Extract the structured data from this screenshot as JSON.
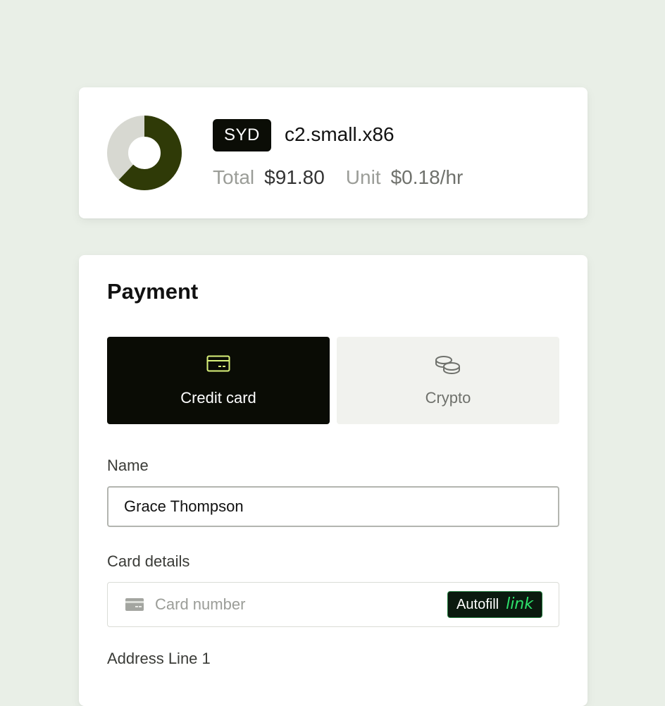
{
  "summary": {
    "region": "SYD",
    "instance": "c2.small.x86",
    "total_label": "Total",
    "total_value": "$91.80",
    "unit_label": "Unit",
    "unit_value": "$0.18/hr",
    "usage_fraction": 0.62,
    "colors": {
      "filled": "#2f3a07",
      "empty": "#d7d8d1"
    }
  },
  "payment": {
    "title": "Payment",
    "methods": [
      {
        "label": "Credit card",
        "icon": "credit-card-icon",
        "selected": true
      },
      {
        "label": "Crypto",
        "icon": "coins-icon",
        "selected": false
      }
    ],
    "name_label": "Name",
    "name_value": "Grace Thompson",
    "card_label": "Card details",
    "card_placeholder": "Card number",
    "autofill_label": "Autofill",
    "autofill_brand": "link",
    "address_label": "Address Line 1"
  }
}
